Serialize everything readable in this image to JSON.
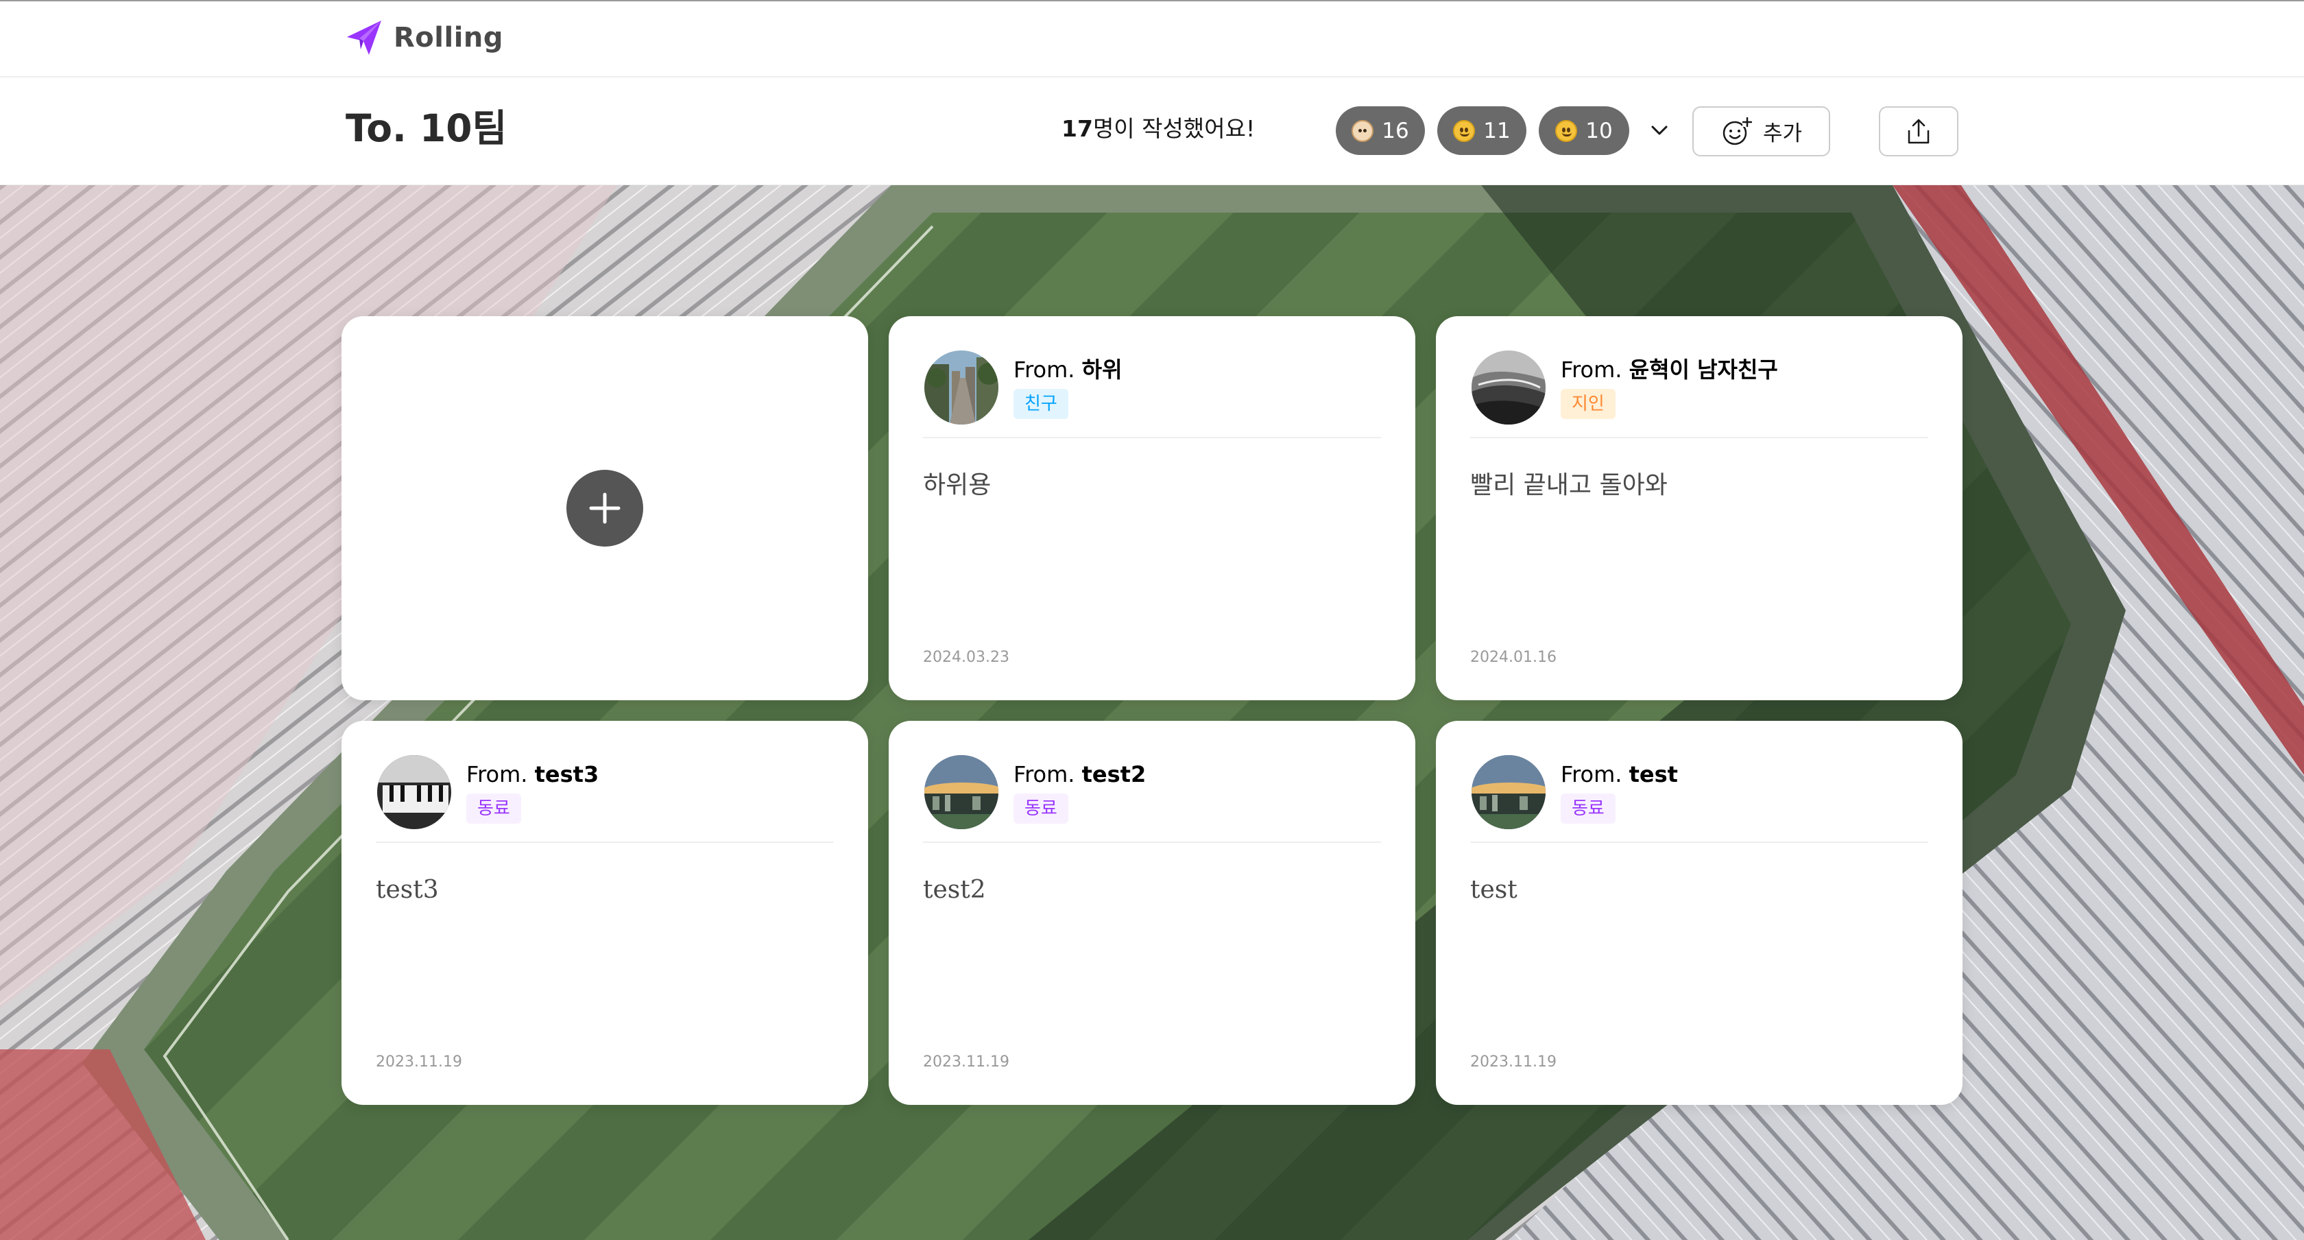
{
  "app": {
    "name": "Rolling"
  },
  "header": {
    "title": "To. 10팀",
    "writers_count": "17",
    "writers_suffix": "명이 작성했어요!",
    "reactions": [
      {
        "emoji": "dog-face",
        "count": "16"
      },
      {
        "emoji": "grinning-face",
        "count": "11"
      },
      {
        "emoji": "grinning-face",
        "count": "10"
      }
    ],
    "add_label": "추가"
  },
  "colors": {
    "brand": "#9935ff",
    "pill": "#6a6a6a",
    "friend_bg": "#e2f5ff",
    "friend_fg": "#00a2fe",
    "acq_bg": "#fff0d6",
    "acq_fg": "#ff8832",
    "col_bg": "#f8f0ff",
    "col_fg": "#9935ff"
  },
  "messages": [
    {
      "from_prefix": "From.",
      "sender": "하위",
      "relationship": "친구",
      "content": "하위용",
      "date": "2024.03.23",
      "avatar": "city-street"
    },
    {
      "from_prefix": "From.",
      "sender": "윤혁이 남자친구",
      "relationship": "지인",
      "content": "빨리 끝내고 돌아와",
      "date": "2024.01.16",
      "avatar": "bw-wave"
    },
    {
      "from_prefix": "From.",
      "sender": "test3",
      "relationship": "동료",
      "content": "test3",
      "date": "2023.11.19",
      "avatar": "bw-piano"
    },
    {
      "from_prefix": "From.",
      "sender": "test2",
      "relationship": "동료",
      "content": "test2",
      "date": "2023.11.19",
      "avatar": "city-sunset"
    },
    {
      "from_prefix": "From.",
      "sender": "test",
      "relationship": "동료",
      "content": "test",
      "date": "2023.11.19",
      "avatar": "city-sunset"
    }
  ]
}
